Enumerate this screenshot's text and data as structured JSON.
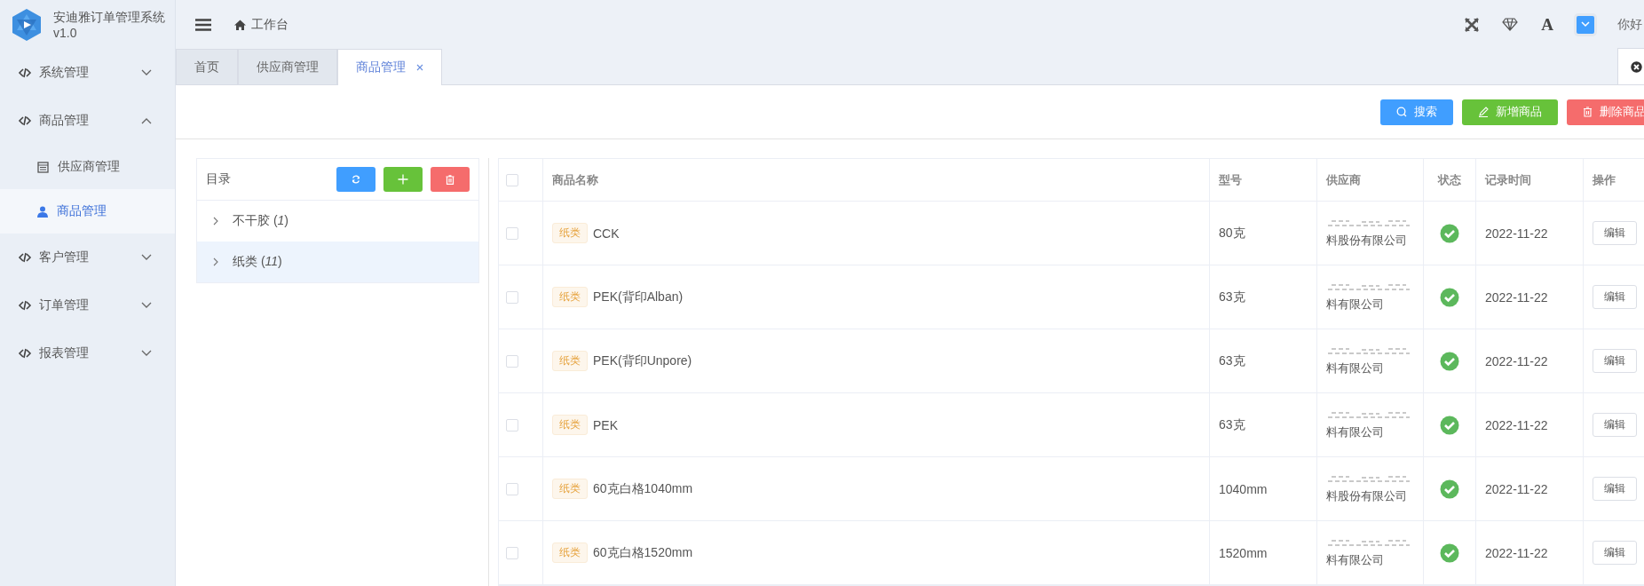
{
  "app": {
    "title": "安迪雅订单管理系统",
    "version": "v1.0"
  },
  "header": {
    "breadcrumb": "工作台",
    "font_icon": "A",
    "greeting": "你好"
  },
  "sidebar": {
    "items": [
      {
        "label": "系统管理",
        "expanded": false
      },
      {
        "label": "商品管理",
        "expanded": true,
        "children": [
          {
            "label": "供应商管理",
            "kind": "list",
            "selected": false
          },
          {
            "label": "商品管理",
            "kind": "user",
            "selected": true
          }
        ]
      },
      {
        "label": "客户管理",
        "expanded": false
      },
      {
        "label": "订单管理",
        "expanded": false
      },
      {
        "label": "报表管理",
        "expanded": false
      }
    ]
  },
  "tabs": [
    {
      "label": "首页",
      "selected": false,
      "closable": false
    },
    {
      "label": "供应商管理",
      "selected": false,
      "closable": false
    },
    {
      "label": "商品管理",
      "selected": true,
      "closable": true
    }
  ],
  "toolbar": {
    "buttons": [
      {
        "label": "搜索",
        "kind": "search"
      },
      {
        "label": "新增商品",
        "kind": "add"
      },
      {
        "label": "删除商品",
        "kind": "delete"
      }
    ]
  },
  "tree": {
    "title": "目录",
    "buttons": [
      {
        "kind": "refresh"
      },
      {
        "kind": "add"
      },
      {
        "kind": "delete"
      }
    ],
    "nodes": [
      {
        "label": "不干胶 (*1*)",
        "selected": false
      },
      {
        "label": "纸类 (*11*)",
        "selected": true
      }
    ]
  },
  "table": {
    "header_checked": false,
    "columns": [
      "商品名称",
      "型号",
      "供应商",
      "状态",
      "记录时间",
      "操作"
    ],
    "rows": [
      {
        "checked": false,
        "tag": "纸类",
        "name": "CCK",
        "model": "80克",
        "supplier": "料股份有限公司",
        "status": true,
        "time": "2022-11-22",
        "action": "编辑"
      },
      {
        "checked": false,
        "tag": "纸类",
        "name": "PEK(背印Alban)",
        "model": "63克",
        "supplier": "料有限公司",
        "status": true,
        "time": "2022-11-22",
        "action": "编辑"
      },
      {
        "checked": false,
        "tag": "纸类",
        "name": "PEK(背印Unpore)",
        "model": "63克",
        "supplier": "料有限公司",
        "status": true,
        "time": "2022-11-22",
        "action": "编辑"
      },
      {
        "checked": false,
        "tag": "纸类",
        "name": "PEK",
        "model": "63克",
        "supplier": "料有限公司",
        "status": true,
        "time": "2022-11-22",
        "action": "编辑"
      },
      {
        "checked": false,
        "tag": "纸类",
        "name": "60克白格1040mm",
        "model": "1040mm",
        "supplier": "料股份有限公司",
        "status": true,
        "time": "2022-11-22",
        "action": "编辑"
      },
      {
        "checked": false,
        "tag": "纸类",
        "name": "60克白格1520mm",
        "model": "1520mm",
        "supplier": "料有限公司",
        "status": true,
        "time": "2022-11-22",
        "action": "编辑"
      }
    ]
  }
}
